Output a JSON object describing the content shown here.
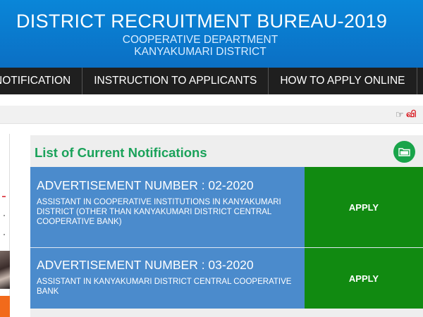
{
  "header": {
    "title": "DISTRICT RECRUITMENT BUREAU-2019",
    "subtitle1": "COOPERATIVE DEPARTMENT",
    "subtitle2": "KANYAKUMARI DISTRICT"
  },
  "nav": {
    "items": [
      {
        "label": "NOTIFICATION"
      },
      {
        "label": "INSTRUCTION TO APPLICANTS"
      },
      {
        "label": "HOW TO APPLY ONLINE"
      }
    ]
  },
  "ticker": {
    "icon": "hand-point-right-icon",
    "text": "வி"
  },
  "notifications": {
    "title": "List of Current Notifications",
    "folder_icon": "folder-icon",
    "items": [
      {
        "number": "ADVERTISEMENT NUMBER : 02-2020",
        "description": "ASSISTANT IN COOPERATIVE INSTITUTIONS IN KANYAKUMARI DISTRICT (OTHER THAN KANYAKUMARI DISTRICT CENTRAL COOPERATIVE BANK)",
        "apply_label": "APPLY"
      },
      {
        "number": "ADVERTISEMENT NUMBER : 03-2020",
        "description": "ASSISTANT IN KANYAKUMARI DISTRICT CENTRAL COOPERATIVE BANK",
        "apply_label": "APPLY"
      }
    ]
  },
  "colors": {
    "header_blue": "#0b7ad0",
    "nav_dark": "#1f1f1f",
    "title_green": "#1aa25a",
    "row_blue": "#4b8bcc",
    "apply_green": "#118a11",
    "ticker_red": "#d8141b"
  }
}
